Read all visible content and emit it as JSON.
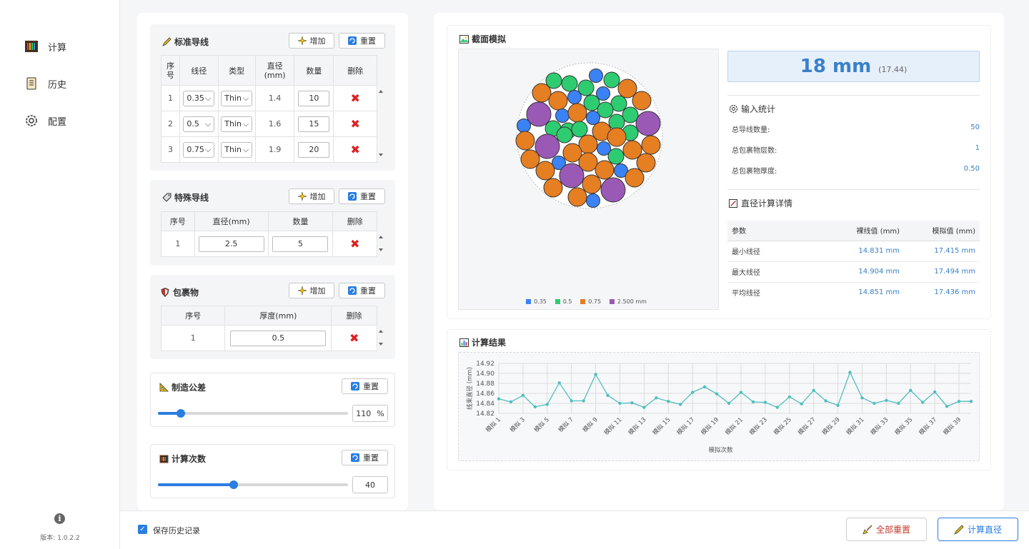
{
  "sidebar": {
    "items": [
      {
        "label": "计算",
        "icon": "abacus-icon"
      },
      {
        "label": "历史",
        "icon": "scroll-icon"
      },
      {
        "label": "配置",
        "icon": "gear-icon"
      }
    ],
    "version": "版本: 1.0.2.2",
    "info_icon": "info-icon",
    "info_glyph": "i"
  },
  "standard_wire": {
    "title": "标准导线",
    "add_label": "增加",
    "reset_label": "重置",
    "headers": [
      "序号",
      "线径",
      "类型",
      "直径(mm)",
      "数量",
      "删除"
    ],
    "rows": [
      {
        "index": "1",
        "gauge": "0.35",
        "type": "Thin",
        "diameter": "1.4",
        "count": "10"
      },
      {
        "index": "2",
        "gauge": "0.5",
        "type": "Thin",
        "diameter": "1.6",
        "count": "15"
      },
      {
        "index": "3",
        "gauge": "0.75",
        "type": "Thin",
        "diameter": "1.9",
        "count": "20"
      }
    ]
  },
  "special_wire": {
    "title": "特殊导线",
    "add_label": "增加",
    "reset_label": "重置",
    "headers": [
      "序号",
      "直径(mm)",
      "数量",
      "删除"
    ],
    "rows": [
      {
        "index": "1",
        "diameter": "2.5",
        "count": "5"
      }
    ]
  },
  "wrapping": {
    "title": "包裹物",
    "add_label": "增加",
    "reset_label": "重置",
    "headers": [
      "序号",
      "厚度(mm)",
      "删除"
    ],
    "rows": [
      {
        "index": "1",
        "thickness": "0.5"
      }
    ]
  },
  "tolerance": {
    "title": "制造公差",
    "reset_label": "重置",
    "value": "110",
    "unit": "%",
    "slider_fraction": 0.12
  },
  "calc_count": {
    "title": "计算次数",
    "reset_label": "重置",
    "value": "40",
    "slider_fraction": 0.4
  },
  "bottom": {
    "save_history_label": "保存历史记录",
    "save_history_checked": true,
    "reset_all_label": "全部重置",
    "calc_label": "计算直径"
  },
  "simulation": {
    "title": "截面模拟",
    "legend": [
      {
        "label": "0.35",
        "color": "#3b82f6"
      },
      {
        "label": "0.5",
        "color": "#2ecc71"
      },
      {
        "label": "0.75",
        "color": "#e67e22"
      },
      {
        "label": "2.500 mm",
        "color": "#9b59b6"
      }
    ]
  },
  "result": {
    "diameter_main": "18 mm",
    "diameter_exact": "(17.44)",
    "input_stats_title": "输入统计",
    "stats": [
      {
        "label": "总导线数量:",
        "value": "50"
      },
      {
        "label": "总包裹物层数:",
        "value": "1"
      },
      {
        "label": "总包裹物厚度:",
        "value": "0.50"
      }
    ],
    "details_title": "直径计算详情",
    "details_headers": [
      "参数",
      "裸线值 (mm)",
      "模拟值 (mm)"
    ],
    "details_rows": [
      {
        "param": "最小线径",
        "bare": "14.831 mm",
        "sim": "17.415 mm"
      },
      {
        "param": "最大线径",
        "bare": "14.904 mm",
        "sim": "17.494 mm"
      },
      {
        "param": "平均线径",
        "bare": "14.851 mm",
        "sim": "17.436 mm"
      }
    ]
  },
  "chart_title": "计算结果",
  "chart_data": {
    "type": "line",
    "xlabel": "模拟次数",
    "ylabel": "线束直径 (mm)",
    "ylim": [
      14.82,
      14.92
    ],
    "yticks": [
      "14.92",
      "14.90",
      "14.88",
      "14.86",
      "14.84",
      "14.82"
    ],
    "xtick_labels": [
      "模拟 1",
      "模拟 3",
      "模拟 5",
      "模拟 7",
      "模拟 9",
      "模拟 11",
      "模拟 13",
      "模拟 15",
      "模拟 17",
      "模拟 19",
      "模拟 21",
      "模拟 23",
      "模拟 25",
      "模拟 27",
      "模拟 29",
      "模拟 31",
      "模拟 33",
      "模拟 35",
      "模拟 37",
      "模拟 39"
    ],
    "color": "#4fbfbf",
    "grid": true,
    "x": [
      1,
      2,
      3,
      4,
      5,
      6,
      7,
      8,
      9,
      10,
      11,
      12,
      13,
      14,
      15,
      16,
      17,
      18,
      19,
      20,
      21,
      22,
      23,
      24,
      25,
      26,
      27,
      28,
      29,
      30,
      31,
      32,
      33,
      34,
      35,
      36,
      37,
      38,
      39,
      40
    ],
    "values": [
      14.849,
      14.843,
      14.856,
      14.833,
      14.838,
      14.881,
      14.845,
      14.845,
      14.898,
      14.856,
      14.84,
      14.841,
      14.832,
      14.851,
      14.844,
      14.838,
      14.862,
      14.873,
      14.859,
      14.84,
      14.862,
      14.843,
      14.842,
      14.832,
      14.853,
      14.839,
      14.866,
      14.845,
      14.836,
      14.902,
      14.851,
      14.84,
      14.846,
      14.84,
      14.866,
      14.842,
      14.863,
      14.834,
      14.844,
      14.844
    ]
  }
}
